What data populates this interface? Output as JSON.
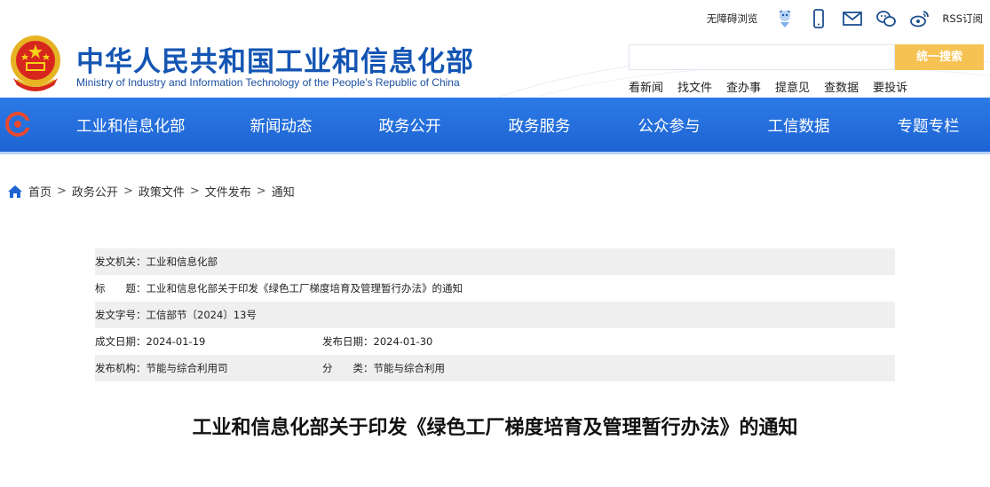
{
  "header": {
    "site_name": "中华人民共和国工业和信息化部",
    "site_name_en": "Ministry of Industry and Information Technology of the People's Republic of China",
    "emblem_icon": "national-emblem-icon",
    "tools": {
      "accessibility": "无障碍浏览",
      "rss": "RSS订阅",
      "icons": [
        "ai-assistant-icon",
        "mobile-icon",
        "mail-icon",
        "wechat-icon",
        "weibo-icon"
      ]
    },
    "search": {
      "placeholder": "",
      "button": "统一搜索"
    },
    "quick_links": [
      "看新闻",
      "找文件",
      "查办事",
      "提意见",
      "查数据",
      "要投诉"
    ]
  },
  "nav": {
    "items": [
      "工业和信息化部",
      "新闻动态",
      "政务公开",
      "政务服务",
      "公众参与",
      "工信数据",
      "专题专栏"
    ]
  },
  "breadcrumb": {
    "items": [
      "首页",
      "政务公开",
      "政策文件",
      "文件发布",
      "通知"
    ],
    "separator": ">"
  },
  "meta": {
    "issuer_label": "发文机关：",
    "issuer": "工业和信息化部",
    "title_label": "标　　题：",
    "title": "工业和信息化部关于印发《绿色工厂梯度培育及管理暂行办法》的通知",
    "doc_no_label": "发文字号：",
    "doc_no": "工信部节〔2024〕13号",
    "created_label": "成文日期：",
    "created": "2024-01-19",
    "published_label": "发布日期：",
    "published": "2024-01-30",
    "org_label": "发布机构：",
    "org": "节能与综合利用司",
    "category_label": "分　　类：",
    "category": "节能与综合利用"
  },
  "document": {
    "heading": "工业和信息化部关于印发《绿色工厂梯度培育及管理暂行办法》的通知"
  },
  "colors": {
    "brand_blue": "#1455b3",
    "nav_blue": "#1d63d2",
    "search_button": "#f6c253",
    "meta_shade": "#efefef"
  }
}
